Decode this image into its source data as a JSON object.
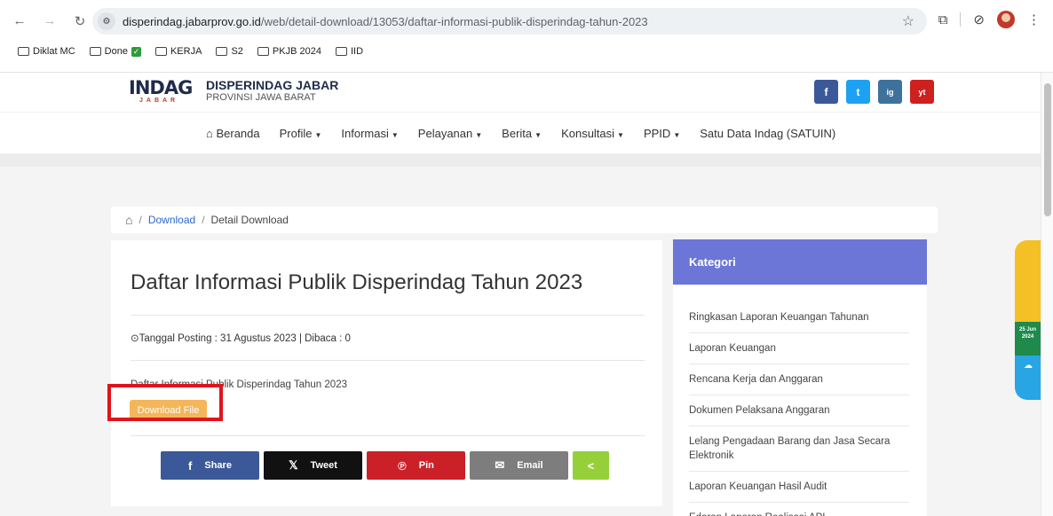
{
  "browser": {
    "url_host": "disperindag.jabarprov.go.id",
    "url_path": "/web/detail-download/13053/daftar-informasi-publik-disperindag-tahun-2023",
    "bookmarks": [
      "Diklat MC",
      "Done",
      "KERJA",
      "S2",
      "PKJB 2024",
      "IID"
    ]
  },
  "site": {
    "logo_text": "INDAG",
    "logo_sub": "JABAR",
    "title": "DISPERINDAG JABAR",
    "subtitle": "PROVINSI JAWA BARAT",
    "social": [
      "f",
      "t",
      "ig",
      "yt"
    ]
  },
  "menu": [
    "Beranda",
    "Profile",
    "Informasi",
    "Pelayanan",
    "Berita",
    "Konsultasi",
    "PPID",
    "Satu Data Indag (SATUIN)"
  ],
  "breadcrumb": {
    "link": "Download",
    "current": "Detail Download"
  },
  "article": {
    "title": "Daftar Informasi Publik Disperindag Tahun 2023",
    "meta": "Tanggal Posting : 31 Agustus 2023 | Dibaca : 0",
    "description": "Daftar Informasi Publik Disperindag Tahun 2023",
    "download_label": "Download File"
  },
  "share": {
    "facebook": "Share",
    "twitter": "Tweet",
    "pinterest": "Pin",
    "email": "Email"
  },
  "sidebar": {
    "title": "Kategori",
    "items": [
      "Ringkasan Laporan Keuangan Tahunan",
      "Laporan Keuangan",
      "Rencana Kerja dan Anggaran",
      "Dokumen Pelaksana Anggaran",
      "Lelang Pengadaan Barang dan Jasa Secara Elektronik",
      "Laporan Keuangan Hasil Audit",
      "Edaran Laporan Realisasi API"
    ]
  },
  "floating_widget": {
    "date": "25 Jun 2024"
  }
}
